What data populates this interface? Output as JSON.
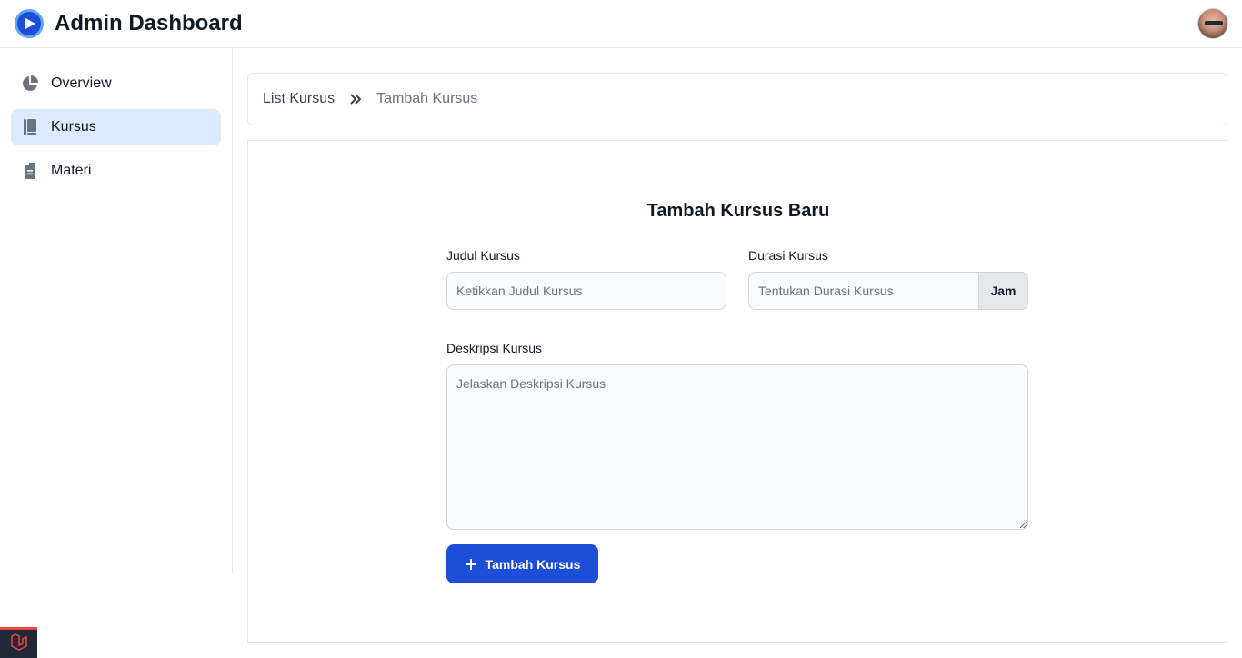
{
  "header": {
    "title": "Admin Dashboard",
    "logo_icon": "play-circle-icon",
    "avatar_icon": "user-avatar"
  },
  "sidebar": {
    "items": [
      {
        "label": "Overview",
        "icon": "pie-chart-icon",
        "active": false
      },
      {
        "label": "Kursus",
        "icon": "book-icon",
        "active": true
      },
      {
        "label": "Materi",
        "icon": "document-icon",
        "active": false
      }
    ]
  },
  "breadcrumb": {
    "items": [
      "List Kursus",
      "Tambah Kursus"
    ],
    "separator_icon": "double-chevron-right-icon"
  },
  "form": {
    "title": "Tambah Kursus Baru",
    "judul_label": "Judul Kursus",
    "judul_placeholder": "Ketikkan Judul Kursus",
    "durasi_label": "Durasi Kursus",
    "durasi_placeholder": "Tentukan Durasi Kursus",
    "durasi_unit": "Jam",
    "deskripsi_label": "Deskripsi Kursus",
    "deskripsi_placeholder": "Jelaskan Deskripsi Kursus",
    "submit_label": "Tambah Kursus"
  },
  "colors": {
    "primary": "#1d4ed8",
    "active_nav_bg": "#dbeafe",
    "border": "#e5e7eb"
  }
}
